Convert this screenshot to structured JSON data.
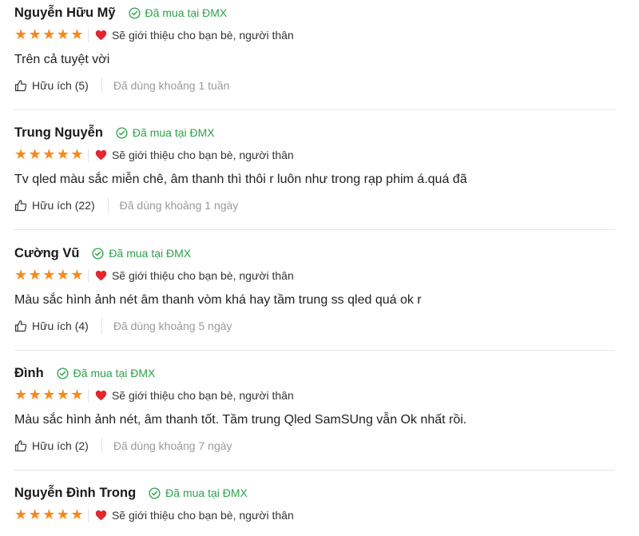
{
  "colors": {
    "star": "#f7891c",
    "verified": "#2ba14b",
    "heart": "#e3262f",
    "used_text": "#9a9a9a",
    "divider": "#e6e6e6"
  },
  "reviews": [
    {
      "author": "Nguyễn Hữu Mỹ",
      "verified_label": "Đã mua tại ĐMX",
      "rating": 5,
      "recommend_text": "Sẽ giới thiệu cho bạn bè, người thân",
      "content": "Trên cả tuyệt vời",
      "helpful_label": "Hữu ích (5)",
      "used_text": "Đã dùng khoảng 1 tuần"
    },
    {
      "author": "Trung Nguyễn",
      "verified_label": "Đã mua tại ĐMX",
      "rating": 5,
      "recommend_text": "Sẽ giới thiệu cho bạn bè, người thân",
      "content": "Tv qled màu sắc miễn chê, âm thanh thì thôi r luôn như trong rạp phim á.quá đã",
      "helpful_label": "Hữu ích (22)",
      "used_text": "Đã dùng khoảng 1 ngày"
    },
    {
      "author": "Cường Vũ",
      "verified_label": "Đã mua tại ĐMX",
      "rating": 5,
      "recommend_text": "Sẽ giới thiệu cho bạn bè, người thân",
      "content": "Màu sắc hình ảnh nét âm thanh vòm khá hay tầm trung ss qled quá ok r",
      "helpful_label": "Hữu ích (4)",
      "used_text": "Đã dùng khoảng 5 ngày"
    },
    {
      "author": "Đình",
      "verified_label": "Đã mua tại ĐMX",
      "rating": 5,
      "recommend_text": "Sẽ giới thiệu cho bạn bè, người thân",
      "content": "Màu sắc hình ảnh nét, âm thanh tốt. Tầm trung Qled SamSUng vẫn Ok nhất rồi.",
      "helpful_label": "Hữu ích (2)",
      "used_text": "Đã dùng khoảng 7 ngày"
    },
    {
      "author": "Nguyễn Đình Trong",
      "verified_label": "Đã mua tại ĐMX",
      "rating": 5,
      "recommend_text": "Sẽ giới thiệu cho bạn bè, người thân"
    }
  ]
}
